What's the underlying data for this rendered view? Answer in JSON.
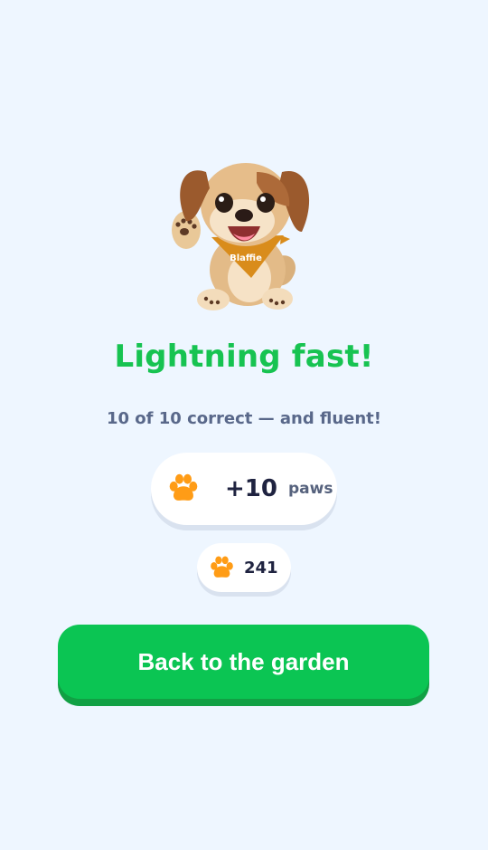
{
  "mascot": {
    "bandana_text": "Blaffie"
  },
  "result": {
    "title": "Lightning fast!",
    "subtitle": "10 of 10 correct — and fluent!"
  },
  "reward": {
    "amount": "+10",
    "unit": "paws",
    "icon": "paw-icon"
  },
  "balance": {
    "value": "241",
    "icon": "paw-icon"
  },
  "actions": {
    "primary_label": "Back to the garden"
  },
  "colors": {
    "background": "#eef6ff",
    "accent_green": "#17c351",
    "button_green": "#0bc553",
    "paw_orange": "#ff9c16"
  }
}
